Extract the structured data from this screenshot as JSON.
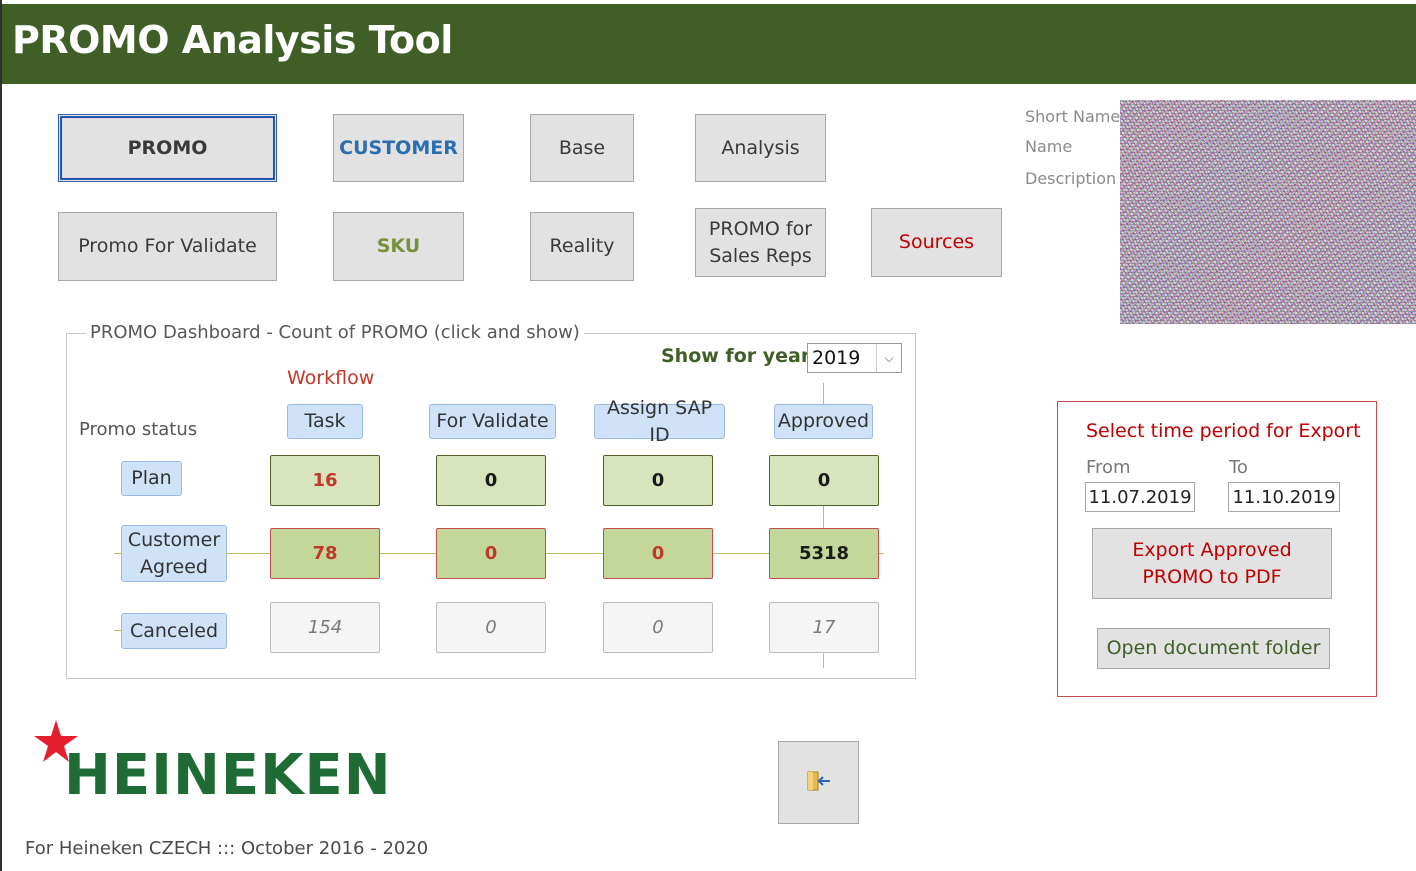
{
  "app": {
    "title": "PROMO Analysis Tool"
  },
  "nav": {
    "promo": "PROMO",
    "customer": "CUSTOMER",
    "base": "Base",
    "analysis": "Analysis",
    "promo_for_validate": "Promo For Validate",
    "sku": "SKU",
    "reality": "Reality",
    "promo_for_sales_reps": "PROMO for Sales Reps",
    "sources": "Sources"
  },
  "user_info": {
    "short_name_label": "Short Name",
    "name_label": "Name",
    "description_label": "Description"
  },
  "dashboard": {
    "title": "PROMO Dashboard - Count of PROMO (click and show)",
    "year_label": "Show for year:",
    "year_value": "2019",
    "workflow_label": "Workflow",
    "status_label": "Promo status",
    "columns": [
      "Task",
      "For Validate",
      "Assign SAP ID",
      "Approved"
    ],
    "rows": [
      {
        "label": "Plan",
        "values": [
          "16",
          "0",
          "0",
          "0"
        ]
      },
      {
        "label": "Customer Agreed",
        "values": [
          "78",
          "0",
          "0",
          "5318"
        ]
      },
      {
        "label": "Canceled",
        "values": [
          "154",
          "0",
          "0",
          "17"
        ]
      }
    ]
  },
  "export": {
    "title": "Select time period for Export",
    "from_label": "From",
    "to_label": "To",
    "from_value": "11.07.2019",
    "to_value": "11.10.2019",
    "export_button": "Export Approved PROMO to PDF",
    "open_folder_button": "Open document folder"
  },
  "brand": {
    "logo_text": "HEINEKEN",
    "logo_color": "#1f6b34",
    "star_color": "#e4202e"
  },
  "footer": {
    "text": "For Heineken CZECH  :::  October 2016 - 2020"
  },
  "colors": {
    "title_bar": "#3f5f27",
    "accent_blue": "#2a6db0",
    "accent_green": "#76923c",
    "accent_red": "#c00000"
  }
}
